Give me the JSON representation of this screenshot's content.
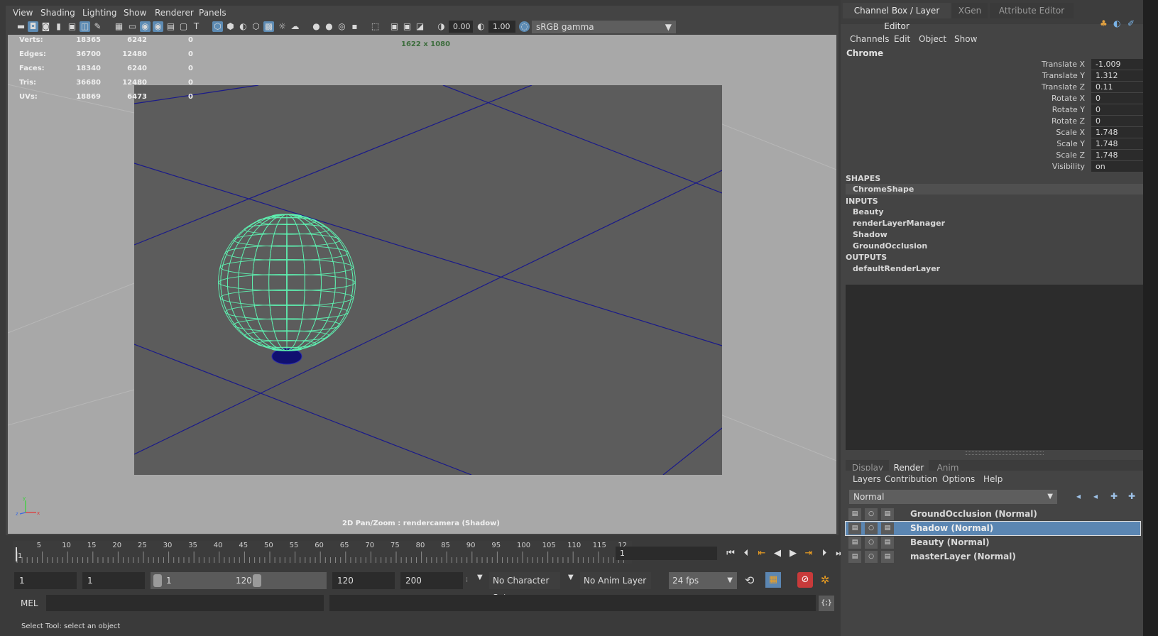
{
  "viewport": {
    "menu": [
      "View",
      "Shading",
      "Lighting",
      "Show",
      "Renderer",
      "Panels"
    ],
    "exposure": "0.00",
    "gamma": "1.00",
    "color_space": "sRGB gamma",
    "resolution": "1622 x 1080",
    "camera_label": "2D Pan/Zoom : rendercamera (Shadow)",
    "hud": [
      {
        "label": "Verts:",
        "a": "18365",
        "b": "6242",
        "c": "0"
      },
      {
        "label": "Edges:",
        "a": "36700",
        "b": "12480",
        "c": "0"
      },
      {
        "label": "Faces:",
        "a": "18340",
        "b": "6240",
        "c": "0"
      },
      {
        "label": "Tris:",
        "a": "36680",
        "b": "12480",
        "c": "0"
      },
      {
        "label": "UVs:",
        "a": "18869",
        "b": "6473",
        "c": "0"
      }
    ],
    "axis": {
      "y": "y",
      "z": "z",
      "x": "x"
    }
  },
  "timeline": {
    "ticks": [
      "5",
      "10",
      "15",
      "20",
      "25",
      "30",
      "35",
      "40",
      "45",
      "50",
      "55",
      "60",
      "65",
      "70",
      "75",
      "80",
      "85",
      "90",
      "95",
      "100",
      "105",
      "110",
      "115",
      "12"
    ],
    "start_tick": "1",
    "current_frame": "1"
  },
  "range": {
    "start": "1",
    "playback_start": "1",
    "slider_start": "1",
    "slider_end": "120",
    "playback_end": "120",
    "end": "200",
    "character_set": "No Character Set",
    "anim_layer": "No Anim Layer",
    "fps": "24 fps"
  },
  "command": {
    "mel_label": "MEL",
    "help_text": "Select Tool: select an object"
  },
  "right_panel": {
    "tabs": [
      "Channel Box / Layer Editor",
      "XGen",
      "Attribute Editor"
    ],
    "channel_menu": [
      "Channels",
      "Edit",
      "Object",
      "Show"
    ],
    "object_name": "Chrome",
    "attributes": [
      {
        "name": "Translate X",
        "value": "-1.009"
      },
      {
        "name": "Translate Y",
        "value": "1.312"
      },
      {
        "name": "Translate Z",
        "value": "0.11"
      },
      {
        "name": "Rotate X",
        "value": "0"
      },
      {
        "name": "Rotate Y",
        "value": "0"
      },
      {
        "name": "Rotate Z",
        "value": "0"
      },
      {
        "name": "Scale X",
        "value": "1.748"
      },
      {
        "name": "Scale Y",
        "value": "1.748"
      },
      {
        "name": "Scale Z",
        "value": "1.748"
      },
      {
        "name": "Visibility",
        "value": "on"
      }
    ],
    "shapes_header": "SHAPES",
    "shapes": [
      "ChromeShape"
    ],
    "inputs_header": "INPUTS",
    "inputs": [
      "Beauty",
      "renderLayerManager",
      "Shadow",
      "GroundOcclusion"
    ],
    "outputs_header": "OUTPUTS",
    "outputs": [
      "defaultRenderLayer"
    ]
  },
  "layer_editor": {
    "tabs": [
      "Display",
      "Render",
      "Anim"
    ],
    "menu": [
      "Layers",
      "Contribution",
      "Options",
      "Help"
    ],
    "blend_mode": "Normal",
    "layers": [
      {
        "name": "GroundOcclusion (Normal)",
        "selected": false
      },
      {
        "name": "Shadow (Normal)",
        "selected": true
      },
      {
        "name": "Beauty (Normal)",
        "selected": false
      },
      {
        "name": "masterLayer (Normal)",
        "selected": false
      }
    ]
  },
  "colors": {
    "wireframe": "#5ef0b0",
    "grid": "#1a1a8a",
    "selection": "#5b86b2",
    "viewport_bg": "#a8a8a8"
  }
}
